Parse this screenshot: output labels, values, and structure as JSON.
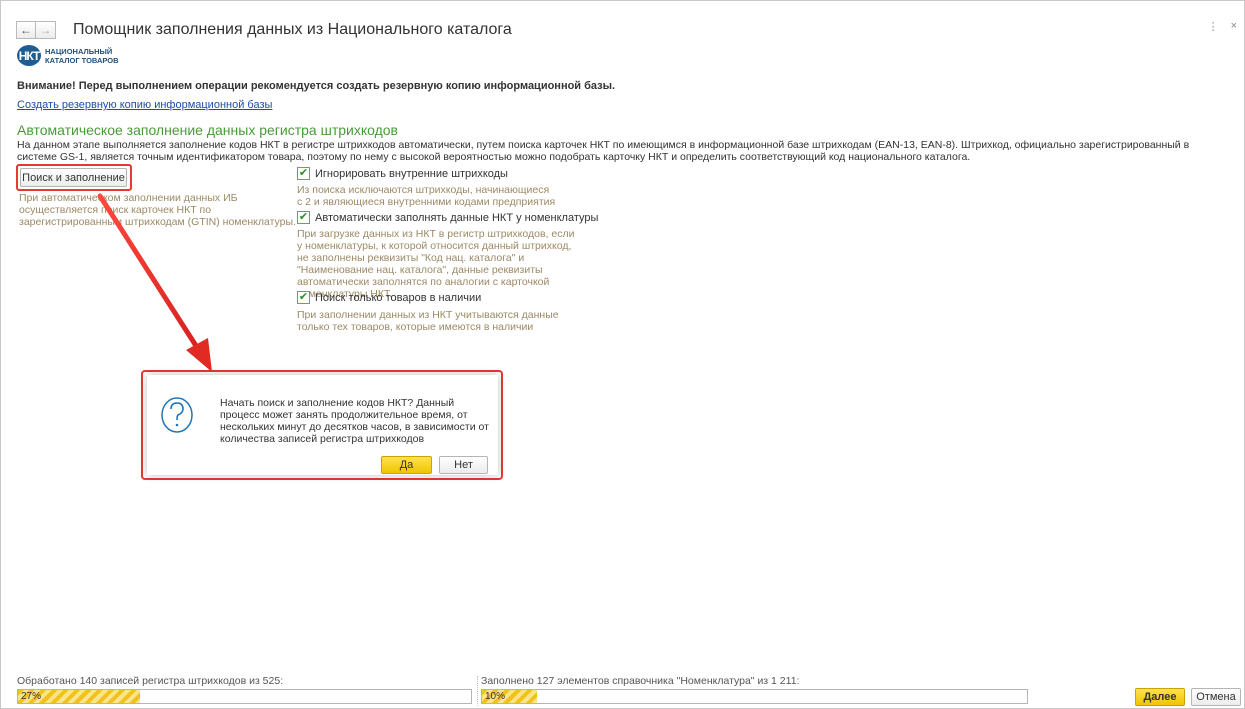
{
  "window": {
    "title": "Помощник заполнения данных из Национального каталога",
    "back_glyph": "←",
    "forward_glyph": "→",
    "menu_glyph": "⋮",
    "close_glyph": "×"
  },
  "logo": {
    "mark": "НКТ",
    "line1": "НАЦИОНАЛЬНЫЙ",
    "line2": "КАТАЛОГ ТОВАРОВ"
  },
  "warning": "Внимание! Перед выполнением операции рекомендуется создать резервную копию информационной базы.",
  "backup_link": "Создать резервную копию информационной базы",
  "section": {
    "title": "Автоматическое заполнение данных регистра штрихкодов",
    "description": "На данном этапе выполняется заполнение кодов НКТ в регистре штрихкодов автоматически, путем поиска карточек НКТ по имеющимся в информационной базе штрихкодам (EAN-13, EAN-8). Штрихкод, официально зарегистрированный в системе GS-1, является точным идентификатором товара, поэтому по нему с высокой вероятностью можно подобрать карточку НКТ и определить соответствующий код национального каталога.",
    "search_button": "Поиск и заполнение",
    "search_hint": "При автоматическом заполнении данных ИБ осуществляется поиск карточек НКТ по зарегистрированным штрихкодам (GTIN) номенклатуры."
  },
  "options": [
    {
      "label": "Игнорировать внутренние штрихкоды",
      "checked": true,
      "hint": "Из поиска исключаются штрихкоды, начинающиеся с 2 и являющиеся внутренними кодами предприятия"
    },
    {
      "label": "Автоматически заполнять данные НКТ у номенклатуры",
      "checked": true,
      "hint": "При загрузке данных из НКТ в регистр штрихкодов, если у номенклатуры, к которой относится данный штрихкод, не заполнены реквизиты \"Код нац. каталога\" и \"Наименование нац. каталога\", данные реквизиты автоматически заполнятся по аналогии с карточкой номенклатуры НКТ."
    },
    {
      "label": "Поиск только товаров в наличии",
      "checked": true,
      "hint": "При заполнении данных из НКТ учитываются данные только тех товаров, которые имеются в наличии"
    }
  ],
  "dialog": {
    "icon": "question-icon",
    "text": "Начать поиск и заполнение кодов НКТ? Данный процесс может занять продолжительное время, от нескольких минут до десятков часов, в зависимости от количества записей регистра штрихкодов",
    "yes": "Да",
    "no": "Нет"
  },
  "progress": {
    "barcodes_label": "Обработано 140 записей регистра штрихкодов из 525:",
    "barcodes_percent_text": "27%",
    "barcodes_fraction": 0.27,
    "items_label": "Заполнено 127 элементов справочника \"Номенклатура\" из 1 211:",
    "items_percent_text": "10%",
    "items_fraction": 0.1
  },
  "footer": {
    "next": "Далее",
    "cancel": "Отмена"
  },
  "colors": {
    "accent_green": "#4a9a3a",
    "highlight_red": "#e53935",
    "button_yellow": "#f0c500",
    "link_blue": "#1a4fa8"
  }
}
